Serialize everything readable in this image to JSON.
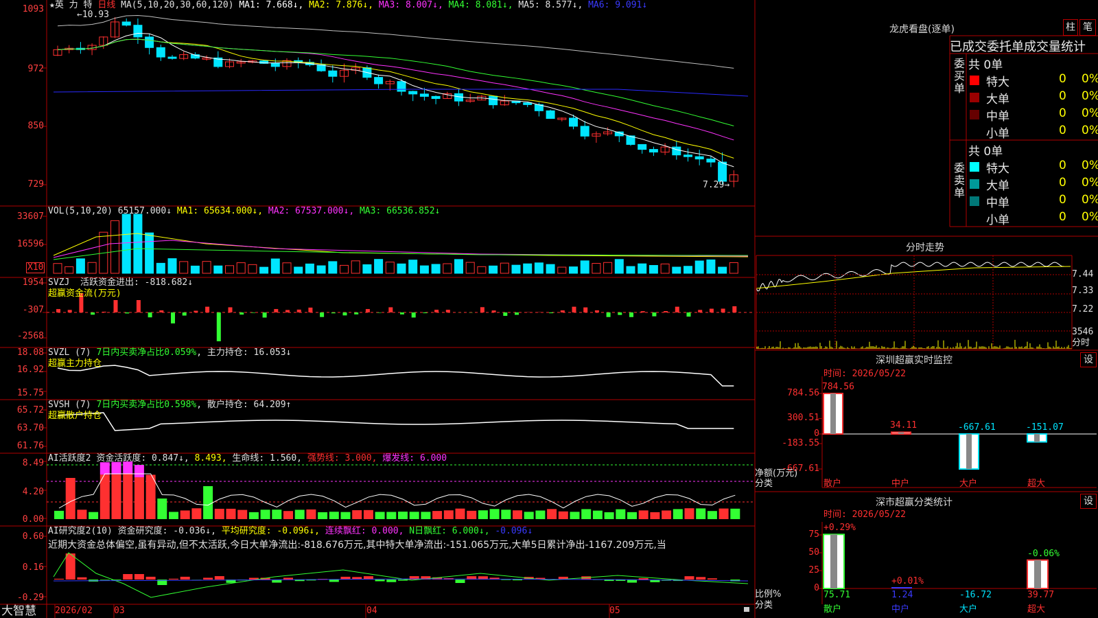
{
  "colors": {
    "up": "#ff3030",
    "down": "#00e5ff",
    "grid": "#b00000",
    "ma1": "#ffffff",
    "ma2": "#ffff00",
    "ma3": "#ff33ff",
    "ma4": "#33ff33",
    "ma5": "#c0c0c0",
    "ma6": "#2a2aff"
  },
  "kline": {
    "symbol_text": "★英 力 特",
    "period": "日线",
    "ma_params": "MA(5,10,20,30,60,120)",
    "ma_items": [
      {
        "text": "MA1: 7.668↓",
        "color": "#ffffff"
      },
      {
        "text": "MA2: 7.876↓",
        "color": "#ffff00"
      },
      {
        "text": "MA3: 8.007↓",
        "color": "#ff33ff"
      },
      {
        "text": "MA4: 8.081↓",
        "color": "#33ff33"
      },
      {
        "text": "MA5: 8.577↓",
        "color": "#e0e0e0"
      },
      {
        "text": "MA6: 9.091↓",
        "color": "#3a3aff"
      }
    ],
    "high_label": "10.93",
    "low_label": "7.29",
    "y_ticks": [
      "1093",
      "972",
      "850",
      "729"
    ]
  },
  "vol": {
    "header": "VOL(5,10,20)",
    "value": "65157.000↓",
    "items": [
      {
        "text": "MA1: 65634.000↓",
        "color": "#ffff00"
      },
      {
        "text": "MA2: 67537.000↓",
        "color": "#ff33ff"
      },
      {
        "text": "MA3: 66536.852↓",
        "color": "#33ff33"
      }
    ],
    "y_ticks": [
      "33607",
      "16596"
    ],
    "unit": "X10"
  },
  "svzj": {
    "header": "SVZJ",
    "label": "活跃资金进出: -818.682↓",
    "sub": "超赢资金流(万元)",
    "y_ticks": [
      "1954",
      "-307",
      "-2568"
    ]
  },
  "svzl": {
    "header": "SVZL (7)",
    "green_text": "7日内买卖净占比0.059%",
    "label": "主力持仓: 16.053↓",
    "sub": "超赢主力持仓",
    "y_ticks": [
      "18.08",
      "16.92",
      "15.75"
    ]
  },
  "svsh": {
    "header": "SVSH (7)",
    "green_text": "7日内买卖净占比0.598%",
    "label": "散户持仓: 64.209↑",
    "sub": "超赢散户持仓",
    "y_ticks": [
      "65.72",
      "63.70",
      "61.76"
    ]
  },
  "ai1": {
    "header": "AI活跃度2",
    "items": [
      {
        "text": "资金活跃度: 0.847↓",
        "color": "#e0e0e0"
      },
      {
        "text": "8.493",
        "color": "#ffff00"
      },
      {
        "text": "生命线: 1.560",
        "color": "#e0e0e0"
      },
      {
        "text": "强势线: 3.000",
        "color": "#ff3030"
      },
      {
        "text": "爆发线: 6.000",
        "color": "#ff33ff"
      }
    ],
    "y_ticks": [
      "8.49",
      "4.20",
      "0.00"
    ]
  },
  "ai2": {
    "header": "AI研究度2(10)",
    "items": [
      {
        "text": "资金研究度: -0.036↓",
        "color": "#e0e0e0"
      },
      {
        "text": "平均研究度: -0.096↓",
        "color": "#ffff00"
      },
      {
        "text": "连续飘红: 0.000",
        "color": "#ff33ff"
      },
      {
        "text": "N日飘红: 6.000↓",
        "color": "#33ff33"
      },
      {
        "text": "-0.096↓",
        "color": "#3a3aff"
      }
    ],
    "commentary": "近期大资金总体偏空,虽有异动,但不太活跃,今日大单净流出:-818.676万元,其中特大单净流出:-151.065万元,大单5日累计净出-1167.209万元,当",
    "y_ticks": [
      "0.60",
      "0.16",
      "-0.29"
    ]
  },
  "time_axis": {
    "brand": "大智慧",
    "labels": [
      "2026/02",
      "03",
      "04",
      "05"
    ]
  },
  "longhu": {
    "title": "龙虎看盘(逐单)",
    "btn_bar": "柱",
    "btn_note": "笔",
    "tabs_text": "已成交委托单成交量统计",
    "buy": {
      "side_label": "委买单",
      "total": "共 0单",
      "rows": [
        {
          "label": "特大",
          "count": "0",
          "pct": "0%",
          "color": "#ff0000"
        },
        {
          "label": "大单",
          "count": "0",
          "pct": "0%",
          "color": "#990000"
        },
        {
          "label": "中单",
          "count": "0",
          "pct": "0%",
          "color": "#660000"
        },
        {
          "label": "小单",
          "count": "0",
          "pct": "0%",
          "color": "#000000"
        }
      ]
    },
    "sell": {
      "side_label": "委卖单",
      "total": "共 0单",
      "rows": [
        {
          "label": "特大",
          "count": "0",
          "pct": "0%",
          "color": "#00ffff"
        },
        {
          "label": "大单",
          "count": "0",
          "pct": "0%",
          "color": "#009999"
        },
        {
          "label": "中单",
          "count": "0",
          "pct": "0%",
          "color": "#007777"
        },
        {
          "label": "小单",
          "count": "0",
          "pct": "0%",
          "color": "#000000"
        }
      ]
    }
  },
  "intraday": {
    "title": "分时走势",
    "price_ticks": [
      "7.44",
      "7.33",
      "7.22"
    ],
    "volume_tick": "3546",
    "volume_unit": "分时"
  },
  "sz_monitor": {
    "title": "深圳超赢实时监控",
    "settings": "设",
    "time": "时间: 2026/05/22",
    "y_ticks": [
      "784.56",
      "300.51",
      "0",
      "-183.55",
      "-667.61"
    ],
    "axis_label": "净额(万元)",
    "cat_label": "分类",
    "bars": [
      {
        "name": "散户",
        "value": 784.56,
        "label": "784.56",
        "color": "#ff3030"
      },
      {
        "name": "中户",
        "value": 34.11,
        "label": "34.11",
        "color": "#ff3030"
      },
      {
        "name": "大户",
        "value": -667.61,
        "label": "-667.61",
        "color": "#00e5ff"
      },
      {
        "name": "超大",
        "value": -151.07,
        "label": "-151.07",
        "color": "#00e5ff"
      }
    ],
    "categories": [
      "散户",
      "中户",
      "大户",
      "超大"
    ],
    "cat_colors": [
      "#ff3030",
      "#ff3030",
      "#ff3030",
      "#ff3030"
    ]
  },
  "sz_class": {
    "title": "深市超赢分类统计",
    "settings": "设",
    "time": "时间: 2026/05/22",
    "y_ticks": [
      "75",
      "50",
      "25",
      "0"
    ],
    "axis_label": "比例%",
    "cat_label": "分类",
    "bars": [
      {
        "name": "散户",
        "ratio": 75.71,
        "ratio_label": "75.71",
        "change": "+0.29%"
      },
      {
        "name": "中户",
        "ratio": 1.24,
        "ratio_label": "1.24",
        "change": "+0.01%"
      },
      {
        "name": "大户",
        "ratio": -16.72,
        "ratio_label": "-16.72",
        "change": ""
      },
      {
        "name": "超大",
        "ratio": 39.77,
        "ratio_label": "39.77",
        "change": "-0.06%"
      }
    ],
    "categories": [
      "散户",
      "中户",
      "大户",
      "超大"
    ]
  }
}
